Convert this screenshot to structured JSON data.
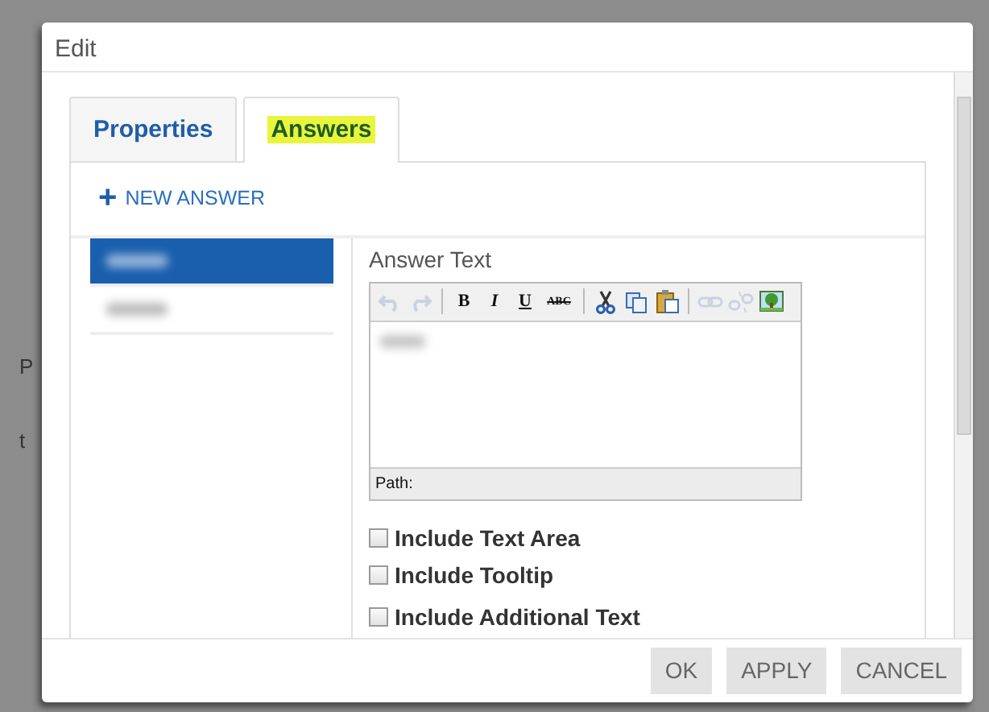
{
  "background": {
    "fragments": [
      "P",
      "t"
    ]
  },
  "dialog": {
    "title": "Edit",
    "tabs": [
      {
        "label": "Properties",
        "selected": false
      },
      {
        "label": "Answers",
        "selected": true,
        "highlighted": true
      }
    ],
    "new_answer": {
      "icon": "+",
      "label": "NEW ANSWER"
    },
    "answers": [
      {
        "selected": true
      },
      {
        "selected": false
      }
    ],
    "answer_text": {
      "label": "Answer Text",
      "toolbar": [
        {
          "kind": "undo",
          "disabled": true
        },
        {
          "kind": "redo",
          "disabled": true
        },
        {
          "kind": "sep"
        },
        {
          "kind": "bold",
          "label": "B"
        },
        {
          "kind": "italic",
          "label": "I"
        },
        {
          "kind": "underline",
          "label": "U"
        },
        {
          "kind": "strike",
          "label": "ABC"
        },
        {
          "kind": "sep"
        },
        {
          "kind": "cut",
          "disabled": false
        },
        {
          "kind": "copy",
          "disabled": false
        },
        {
          "kind": "paste",
          "disabled": false
        },
        {
          "kind": "sep"
        },
        {
          "kind": "link",
          "disabled": true
        },
        {
          "kind": "unlink",
          "disabled": true
        },
        {
          "kind": "image",
          "disabled": false
        }
      ],
      "path_label": "Path:"
    },
    "options": [
      {
        "label": "Include Text Area",
        "checked": false
      },
      {
        "label": "Include Tooltip",
        "checked": false
      },
      {
        "label": "Include Additional Text",
        "checked": false
      }
    ],
    "buttons": [
      "OK",
      "APPLY",
      "CANCEL"
    ]
  }
}
